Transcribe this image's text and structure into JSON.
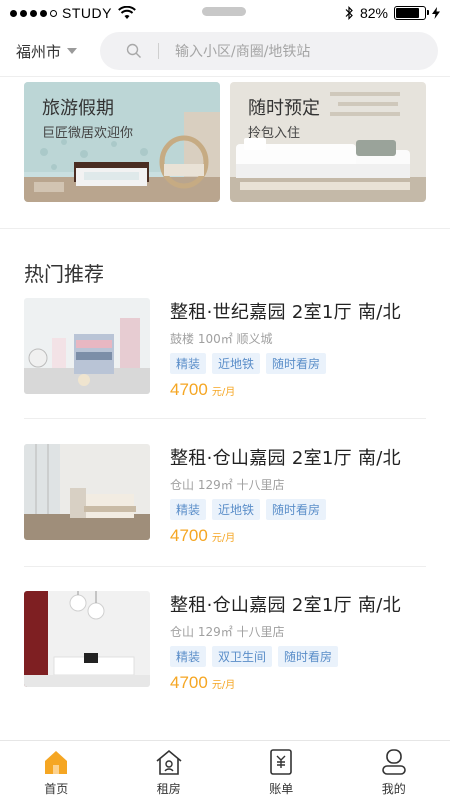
{
  "status_bar": {
    "carrier": "STUDY",
    "battery_percent": "82%",
    "battery_level": 0.82
  },
  "header": {
    "city": "福州市",
    "search_placeholder": "输入小区/商圈/地铁站"
  },
  "banners": [
    {
      "title": "旅游假期",
      "subtitle": "巨匠微居欢迎你"
    },
    {
      "title": "随时预定",
      "subtitle": "拎包入住"
    }
  ],
  "section": {
    "title": "热门推荐"
  },
  "listings": [
    {
      "name": "整租·世纪嘉园 2室1厅 南/北",
      "meta": "鼓楼 100㎡ 顺义城",
      "tags": [
        "精装",
        "近地铁",
        "随时看房"
      ],
      "price": "4700",
      "price_unit": "元/月"
    },
    {
      "name": "整租·仓山嘉园 2室1厅 南/北",
      "meta": "仓山 129㎡ 十八里店",
      "tags": [
        "精装",
        "近地铁",
        "随时看房"
      ],
      "price": "4700",
      "price_unit": "元/月"
    },
    {
      "name": "整租·仓山嘉园 2室1厅 南/北",
      "meta": "仓山 129㎡ 十八里店",
      "tags": [
        "精装",
        "双卫生间",
        "随时看房"
      ],
      "price": "4700",
      "price_unit": "元/月"
    }
  ],
  "tabbar": {
    "items": [
      {
        "label": "首页",
        "icon": "home-icon",
        "active": true
      },
      {
        "label": "租房",
        "icon": "house-icon",
        "active": false
      },
      {
        "label": "账单",
        "icon": "bill-icon",
        "active": false
      },
      {
        "label": "我的",
        "icon": "user-icon",
        "active": false
      }
    ]
  },
  "colors": {
    "accent": "#f5a623",
    "tag_text": "#5b8ec9",
    "tag_bg": "#eaf2fb"
  }
}
